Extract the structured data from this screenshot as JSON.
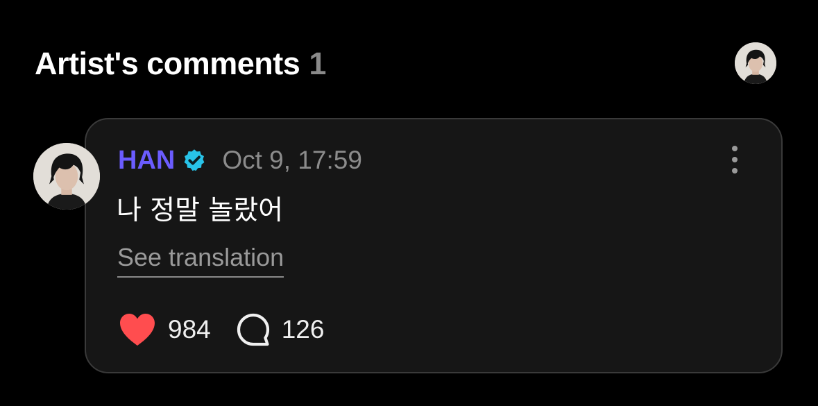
{
  "header": {
    "title": "Artist's comments",
    "count": "1"
  },
  "comment": {
    "author": "HAN",
    "verified": true,
    "timestamp": "Oct 9, 17:59",
    "text": "나 정말 놀랐어",
    "translate_label": "See translation",
    "likes": "984",
    "replies": "126"
  },
  "colors": {
    "background": "#000000",
    "card_background": "#161616",
    "author_name": "#6b5cff",
    "verified_badge": "#28c3e8",
    "like_heart": "#ff4d4f",
    "muted_text": "#8c8c8c"
  },
  "icons": {
    "verified": "verified-badge-icon",
    "more": "more-vertical-icon",
    "like": "heart-icon",
    "reply": "chat-bubble-icon"
  }
}
